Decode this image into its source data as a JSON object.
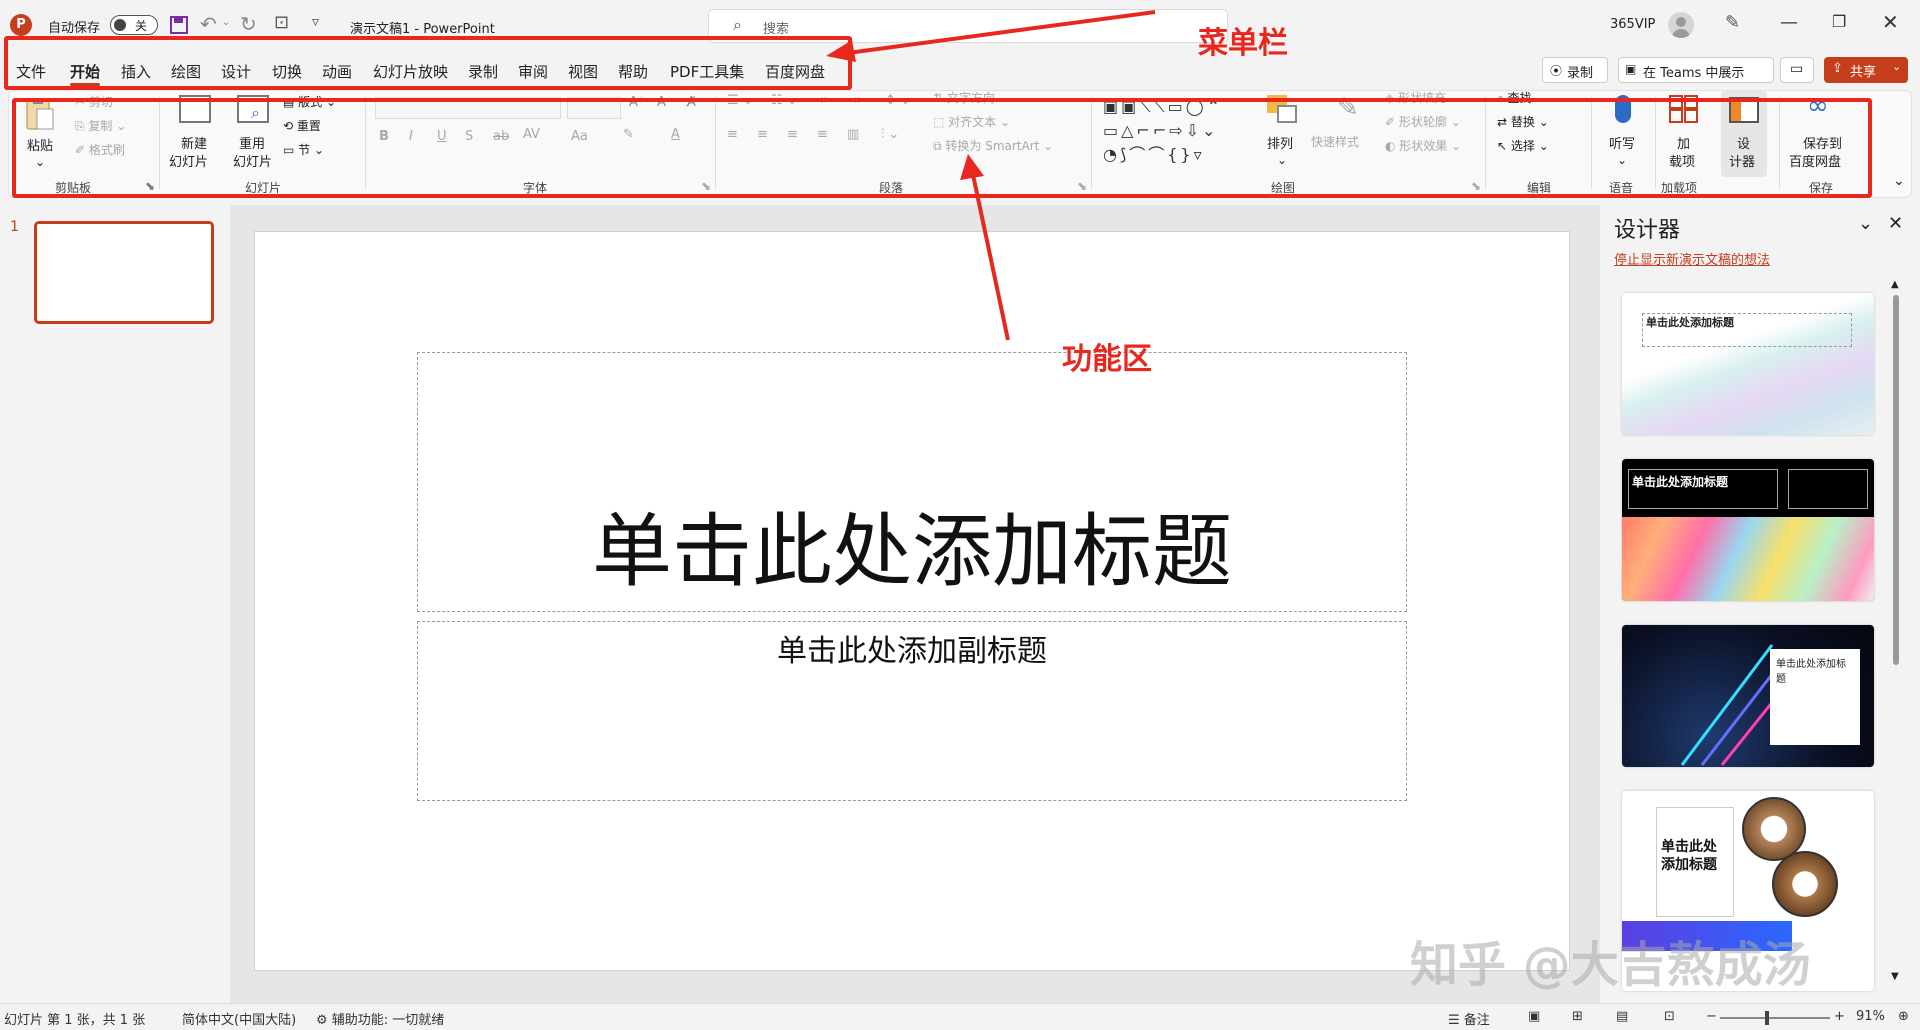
{
  "titlebar": {
    "autosave_label": "自动保存",
    "autosave_state": "关",
    "doc_title": "演示文稿1  -  PowerPoint",
    "search_placeholder": "搜索",
    "account": "365VIP"
  },
  "menu": {
    "tabs": [
      "文件",
      "开始",
      "插入",
      "绘图",
      "设计",
      "切换",
      "动画",
      "幻灯片放映",
      "录制",
      "审阅",
      "视图",
      "帮助",
      "PDF工具集",
      "百度网盘"
    ],
    "active_tab": "开始",
    "record_button": "录制",
    "teams_button": "在 Teams 中展示",
    "share_button": "共享"
  },
  "ribbon": {
    "clipboard": {
      "paste": "粘贴",
      "cut": "剪切",
      "copy": "复制",
      "format_painter": "格式刷",
      "label": "剪贴板"
    },
    "slides": {
      "new_slide_1": "新建",
      "new_slide_2": "幻灯片",
      "reuse_1": "重用",
      "reuse_2": "幻灯片",
      "layout": "版式",
      "reset": "重置",
      "section": "节",
      "label": "幻灯片"
    },
    "font": {
      "bold": "B",
      "italic": "I",
      "underline": "U",
      "shadow": "S",
      "strike": "ab",
      "spacing": "AV",
      "case": "Aa",
      "label": "字体"
    },
    "paragraph": {
      "text_direction": "文字方向",
      "align_text": "对齐文本",
      "smartart": "转换为 SmartArt",
      "label": "段落"
    },
    "drawing": {
      "arrange": "排列",
      "quick_styles": "快速样式",
      "shape_fill": "形状填充",
      "shape_outline": "形状轮廓",
      "shape_effects": "形状效果",
      "label": "绘图"
    },
    "editing": {
      "find": "查找",
      "replace": "替换",
      "select": "选择",
      "label": "编辑"
    },
    "voice": {
      "dictate": "听写",
      "label": "语音"
    },
    "addins": {
      "addins_1": "加",
      "addins_2": "载项",
      "label": "加载项"
    },
    "designer": {
      "btn_1": "设",
      "btn_2": "计器"
    },
    "save": {
      "btn_1": "保存到",
      "btn_2": "百度网盘",
      "label": "保存"
    }
  },
  "annotations": {
    "menubar": "菜单栏",
    "ribbon": "功能区"
  },
  "slide_panel": {
    "number": "1"
  },
  "slide": {
    "title": "单击此处添加标题",
    "subtitle": "单击此处添加副标题"
  },
  "designer_pane": {
    "title": "设计器",
    "link": "停止显示新演示文稿的想法",
    "thumb_titles": [
      "单击此处添加标题",
      "单击此处添加标题",
      "单击此处添加标题",
      "单击此处添加标题"
    ]
  },
  "watermark": "知乎 @大吉熬成汤",
  "status": {
    "slide_info": "幻灯片 第 1 张，共 1 张",
    "language": "简体中文(中国大陆)",
    "accessibility": "辅助功能: 一切就绪",
    "notes": "备注",
    "zoom": "91%"
  },
  "colors": {
    "accent": "#c43e1c",
    "annotation_red": "#e8271f",
    "share_bg": "#c43e1c"
  }
}
